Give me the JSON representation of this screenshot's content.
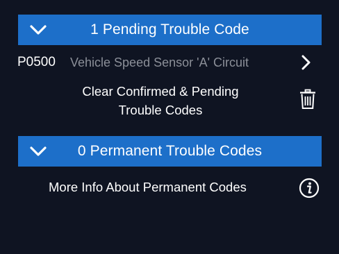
{
  "pending_section": {
    "title": "1 Pending Trouble Code",
    "icon": "chevron-down-icon"
  },
  "codes": [
    {
      "id": "P0500",
      "description": "Vehicle Speed Sensor 'A' Circuit",
      "icon": "chevron-right-icon"
    }
  ],
  "clear_action": {
    "line1": "Clear Confirmed & Pending",
    "line2": "Trouble Codes",
    "icon": "trash-icon"
  },
  "permanent_section": {
    "title": "0 Permanent Trouble Codes",
    "icon": "chevron-down-icon"
  },
  "info_action": {
    "label": "More Info About Permanent Codes",
    "icon": "info-icon"
  },
  "colors": {
    "background": "#0f1422",
    "header_blue": "#1d6fc9",
    "text_primary": "#ffffff",
    "text_secondary": "#8b8f98"
  }
}
